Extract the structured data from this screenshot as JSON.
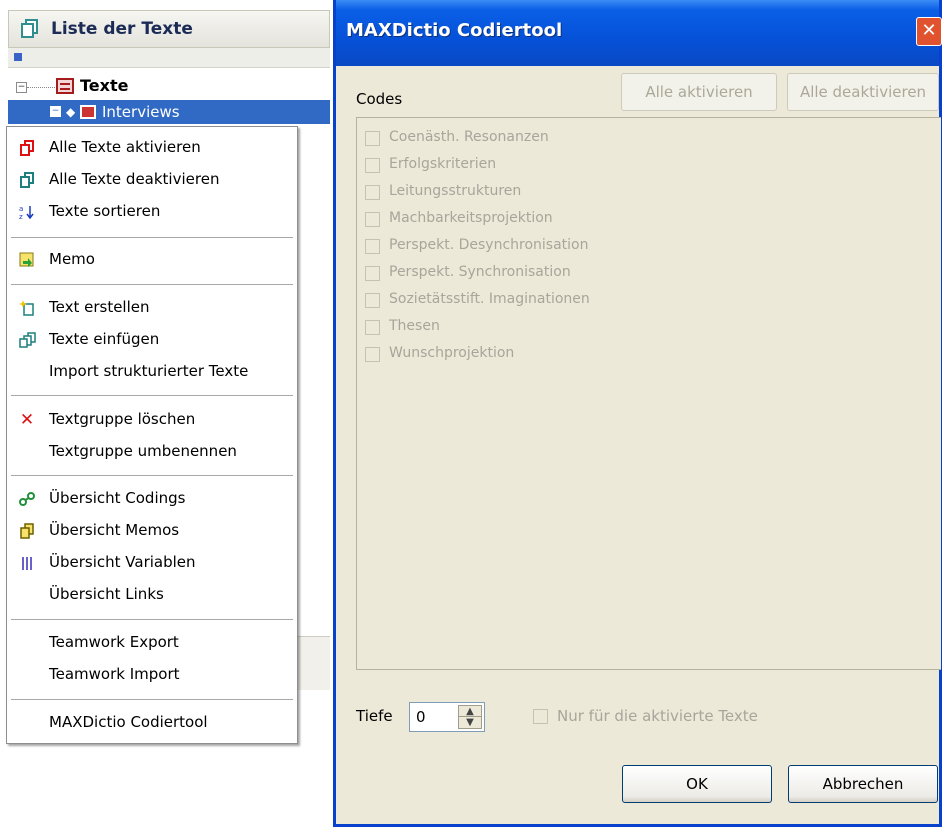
{
  "left_panel": {
    "header_title": "Liste der Texte",
    "tree": {
      "root_label": "Texte",
      "root_expander": "−",
      "selected_item_label": "Interviews",
      "selected_expander": "−"
    }
  },
  "context_menu": {
    "items": [
      {
        "label": "Alle Texte aktivieren",
        "icon": "red-pages-icon"
      },
      {
        "label": "Alle Texte deaktivieren",
        "icon": "teal-pages-icon"
      },
      {
        "label": "Texte sortieren",
        "icon": "sort-az-icon"
      },
      {
        "label": "Memo",
        "icon": "memo-icon"
      },
      {
        "label": "Text erstellen",
        "icon": "new-text-icon"
      },
      {
        "label": "Texte einfügen",
        "icon": "insert-texts-icon"
      },
      {
        "label": "Import strukturierter Texte",
        "icon": ""
      },
      {
        "label": "Textgruppe löschen",
        "icon": "delete-x-icon"
      },
      {
        "label": "Textgruppe umbenennen",
        "icon": ""
      },
      {
        "label": "Übersicht Codings",
        "icon": "codings-icon"
      },
      {
        "label": "Übersicht Memos",
        "icon": "memos-icon"
      },
      {
        "label": "Übersicht Variablen",
        "icon": "variables-icon"
      },
      {
        "label": "Übersicht Links",
        "icon": ""
      },
      {
        "label": "Teamwork Export",
        "icon": ""
      },
      {
        "label": "Teamwork Import",
        "icon": ""
      },
      {
        "label": "MAXDictio Codiertool",
        "icon": ""
      }
    ]
  },
  "dialog": {
    "title": "MAXDictio Codiertool",
    "close_glyph": "✕",
    "codes_label": "Codes",
    "activate_all": "Alle aktivieren",
    "deactivate_all": "Alle deaktivieren",
    "codes": [
      {
        "label": "Coenästh. Resonanzen",
        "checked": false
      },
      {
        "label": "Erfolgskriterien",
        "checked": false
      },
      {
        "label": "Leitungsstrukturen",
        "checked": false
      },
      {
        "label": "Machbarkeitsprojektion",
        "checked": false
      },
      {
        "label": "Perspekt. Desynchronisation",
        "checked": false
      },
      {
        "label": "Perspekt. Synchronisation",
        "checked": false
      },
      {
        "label": "Sozietätsstift. Imaginationen",
        "checked": false
      },
      {
        "label": "Thesen",
        "checked": false
      },
      {
        "label": "Wunschprojektion",
        "checked": false
      }
    ],
    "depth_label": "Tiefe",
    "depth_value": "0",
    "spin_up": "▲",
    "spin_down": "▼",
    "only_active_label": "Nur für die aktivierte Texte",
    "ok": "OK",
    "cancel": "Abbrechen"
  },
  "colors": {
    "selection": "#316ac5",
    "titlebar": "#0551d8",
    "dialog_bg": "#ece9d8",
    "close_button": "#e0532e"
  }
}
